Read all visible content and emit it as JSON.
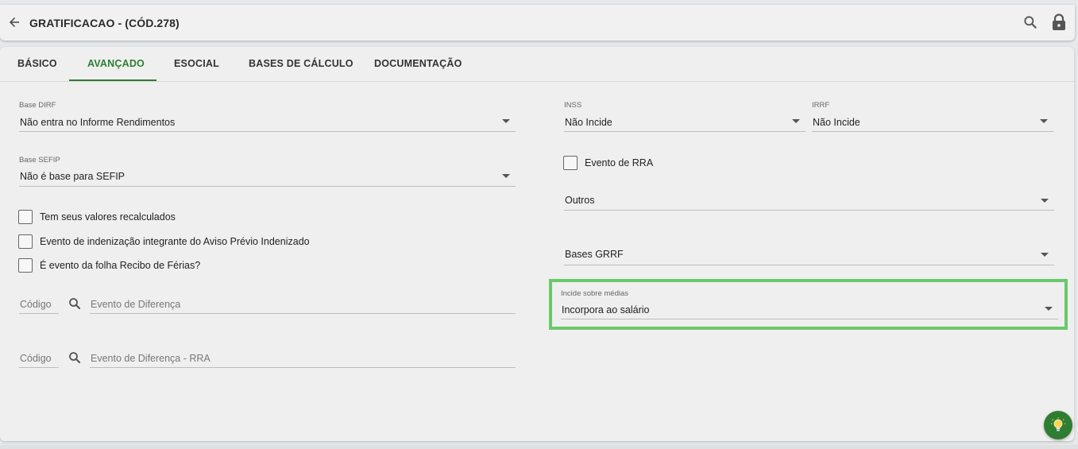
{
  "header": {
    "title": "GRATIFICACAO - (CÓD.278)"
  },
  "tabs": [
    {
      "label": "BÁSICO"
    },
    {
      "label": "AVANÇADO",
      "active": true
    },
    {
      "label": "ESOCIAL"
    },
    {
      "label": "BASES DE CÁLCULO"
    },
    {
      "label": "DOCUMENTAÇÃO"
    }
  ],
  "left": {
    "base_dirf": {
      "label": "Base DIRF",
      "value": "Não entra no Informe Rendimentos"
    },
    "base_sefip": {
      "label": "Base SEFIP",
      "value": "Não é base para SEFIP"
    },
    "checkboxes": [
      {
        "label": "Tem seus valores recalculados",
        "checked": false
      },
      {
        "label": "Evento de indenização integrante do Aviso Prévio Indenizado",
        "checked": false
      },
      {
        "label": "É evento da folha Recibo de Férias?",
        "checked": false
      }
    ],
    "evento_diferenca": {
      "code_placeholder": "Código",
      "name_placeholder": "Evento de Diferença"
    },
    "evento_diferenca_rra": {
      "code_placeholder": "Código",
      "name_placeholder": "Evento de Diferença - RRA"
    }
  },
  "right": {
    "inss": {
      "label": "INSS",
      "value": "Não Incide"
    },
    "irrf": {
      "label": "IRRF",
      "value": "Não Incide"
    },
    "evento_rra": {
      "label": "Evento de RRA",
      "checked": false
    },
    "outros": {
      "placeholder": "Outros"
    },
    "bases_grrf": {
      "placeholder": "Bases GRRF"
    },
    "incide_medias": {
      "label": "Incide sobre médias",
      "value": "Incorpora ao salário"
    }
  },
  "colors": {
    "accent": "#2e7d32",
    "highlight": "#6ac96a"
  }
}
